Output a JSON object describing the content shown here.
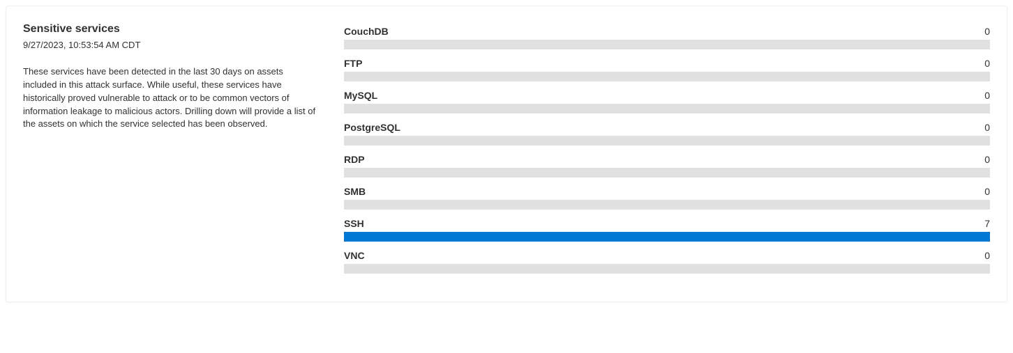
{
  "chart_data": {
    "type": "bar",
    "categories": [
      "CouchDB",
      "FTP",
      "MySQL",
      "PostgreSQL",
      "RDP",
      "SMB",
      "SSH",
      "VNC"
    ],
    "values": [
      0,
      0,
      0,
      0,
      0,
      0,
      7,
      0
    ],
    "title": "Sensitive services",
    "xlabel": "",
    "ylabel": "",
    "ylim": [
      0,
      7
    ]
  },
  "panel": {
    "title": "Sensitive services",
    "timestamp": "9/27/2023, 10:53:54 AM CDT",
    "description": "These services have been detected in the last 30 days on assets included in this attack surface. While useful, these services have historically proved vulnerable to attack or to be common vectors of information leakage to malicious actors. Drilling down will provide a list of the assets on which the service selected has been observed."
  },
  "services": [
    {
      "name": "CouchDB",
      "count": 0
    },
    {
      "name": "FTP",
      "count": 0
    },
    {
      "name": "MySQL",
      "count": 0
    },
    {
      "name": "PostgreSQL",
      "count": 0
    },
    {
      "name": "RDP",
      "count": 0
    },
    {
      "name": "SMB",
      "count": 0
    },
    {
      "name": "SSH",
      "count": 7
    },
    {
      "name": "VNC",
      "count": 0
    }
  ]
}
